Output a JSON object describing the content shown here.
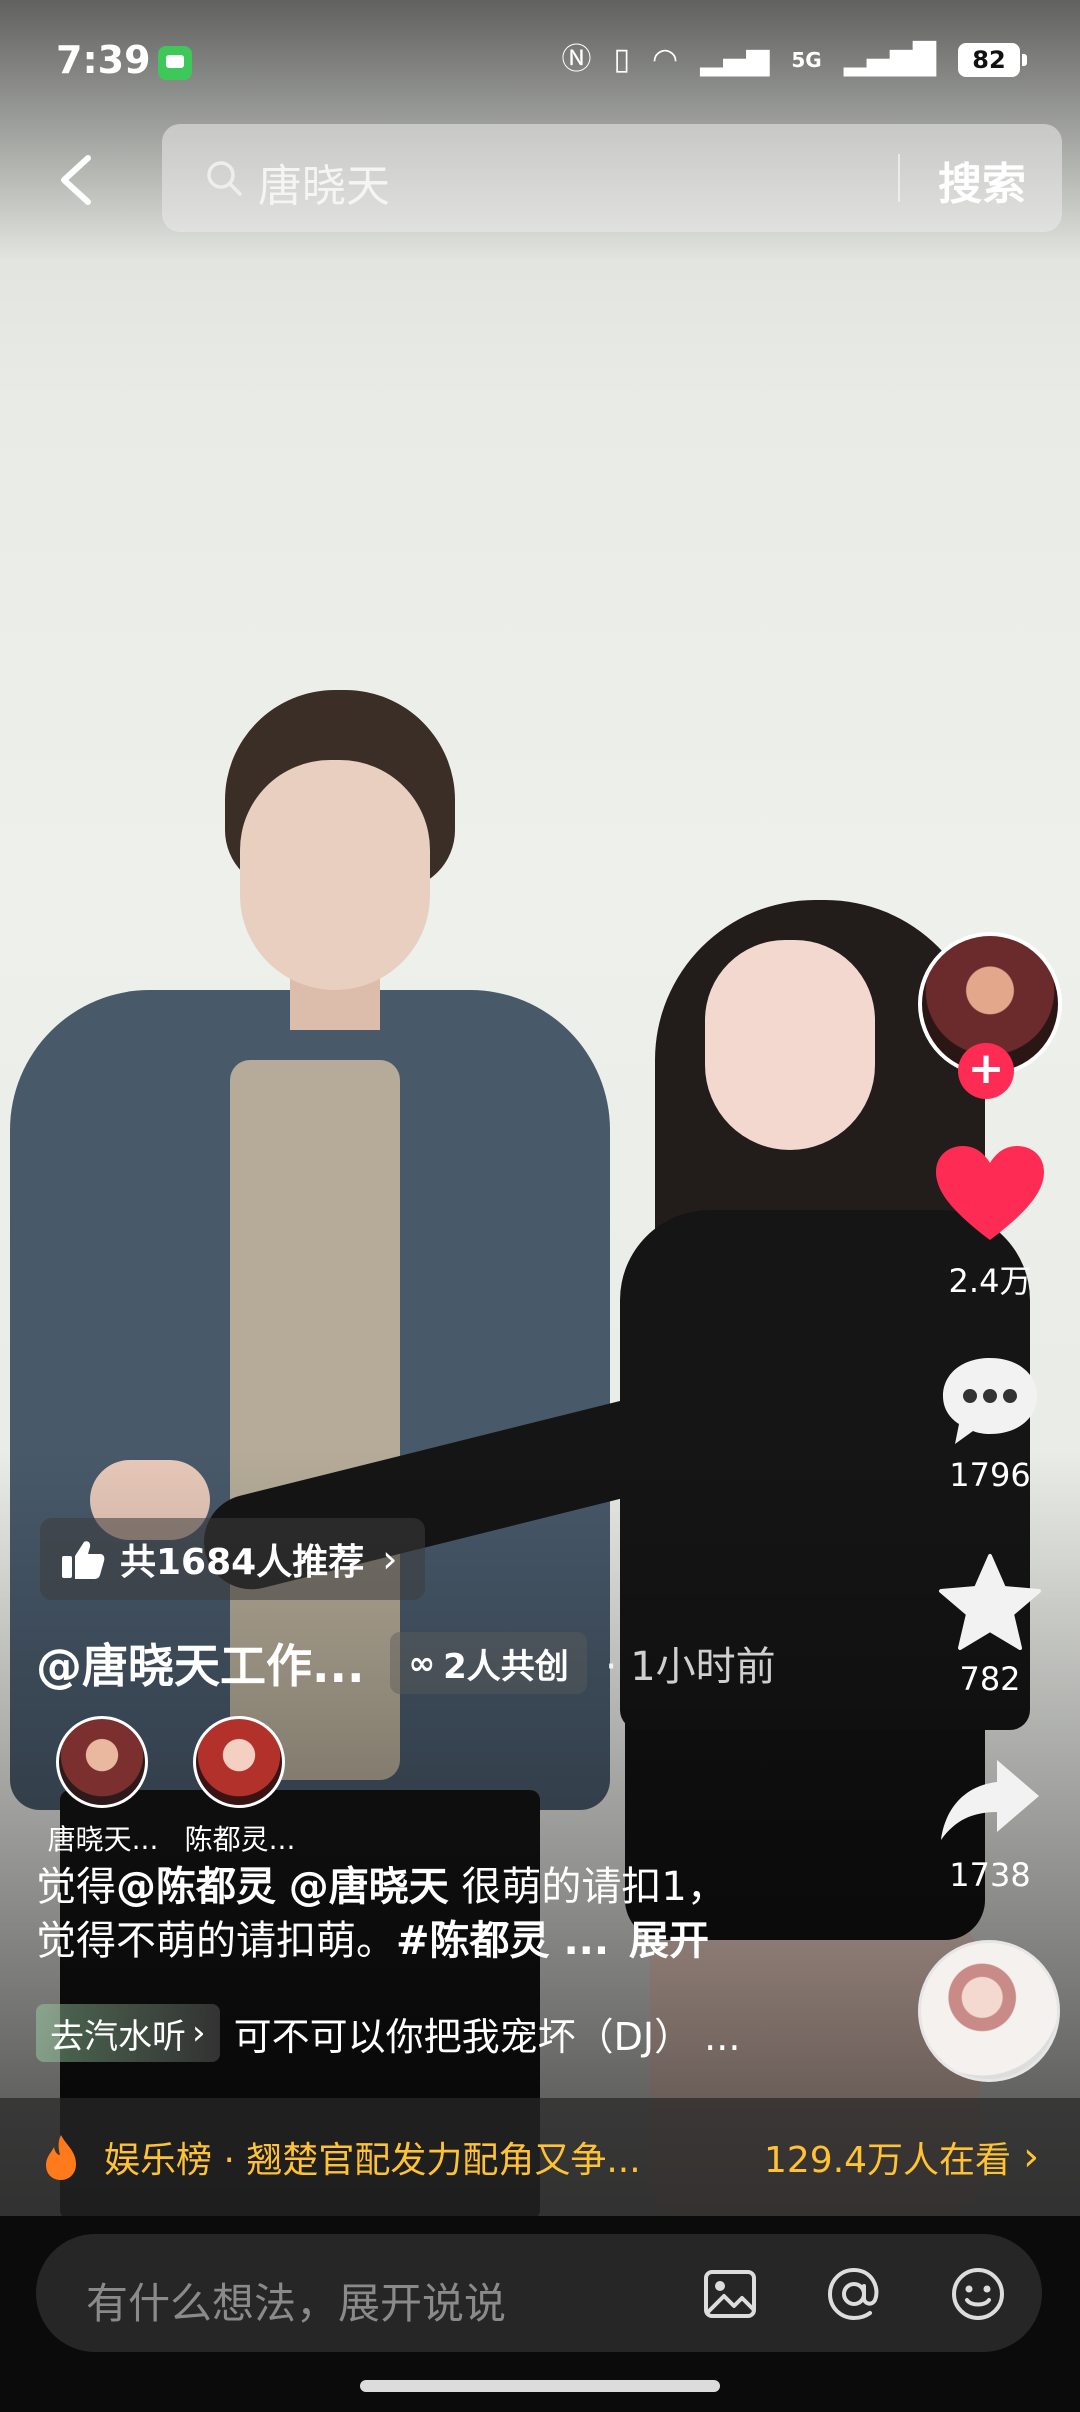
{
  "status_bar": {
    "time": "7:39",
    "battery": "82",
    "network_label": "5G"
  },
  "search": {
    "query": "唐晓天",
    "button_label": "搜索"
  },
  "right_rail": {
    "likes": "2.4万",
    "comments": "1796",
    "favorites": "782",
    "shares": "1738",
    "follow_symbol": "+"
  },
  "post": {
    "recommend_text": "共1684人推荐",
    "author": "@唐晓天工作...",
    "co_create": "2人共创",
    "time_ago": "· 1小时前",
    "co_creators": [
      {
        "name": "唐晓天..."
      },
      {
        "name": "陈都灵..."
      }
    ],
    "caption_prefix": "觉得",
    "mention1": "@陈都灵",
    "mention2": "@唐晓天",
    "caption_mid": " 很萌的请扣1，",
    "caption_line2": "觉得不萌的请扣萌。",
    "hashtag": "#陈都灵 ...",
    "expand": "展开",
    "music_tag": "去汽水听",
    "song": "可不可以你把我宠坏（DJ） ..."
  },
  "hot_bar": {
    "title": "娱乐榜 · 翘楚官配发力配角又争...",
    "watching": "129.4万人在看"
  },
  "comment_bar": {
    "placeholder": "有什么想法，展开说说"
  },
  "colors": {
    "like_red": "#fe2c55",
    "hot_yellow": "#ffc233"
  }
}
